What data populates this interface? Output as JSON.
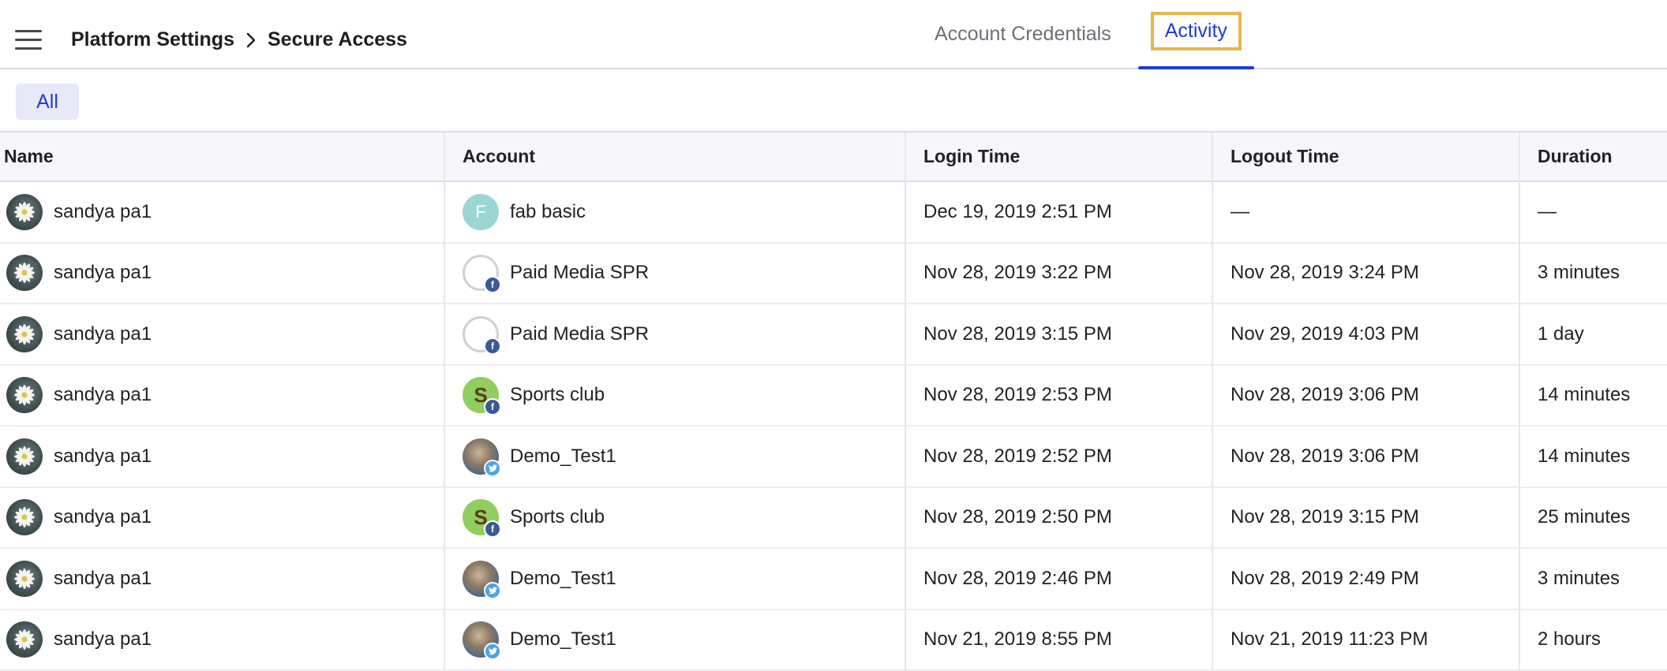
{
  "header": {
    "breadcrumb": [
      "Platform Settings",
      "Secure Access"
    ],
    "tabs": [
      {
        "label": "Account Credentials",
        "active": false
      },
      {
        "label": "Activity",
        "active": true
      }
    ],
    "accent_color": "#1c3ccf",
    "highlight_color": "#e8b64c"
  },
  "filters": {
    "chip": "All"
  },
  "table": {
    "columns": [
      "Name",
      "Account",
      "Login Time",
      "Logout Time",
      "Duration"
    ],
    "rows": [
      {
        "name": "sandya pa1",
        "account": "fab basic",
        "account_avatar": "letter-F",
        "network": "",
        "login": "Dec 19, 2019 2:51 PM",
        "logout": "—",
        "duration": "—"
      },
      {
        "name": "sandya pa1",
        "account": "Paid Media SPR",
        "account_avatar": "placeholder",
        "network": "facebook",
        "login": "Nov 28, 2019 3:22 PM",
        "logout": "Nov 28, 2019 3:24 PM",
        "duration": "3 minutes"
      },
      {
        "name": "sandya pa1",
        "account": "Paid Media SPR",
        "account_avatar": "placeholder",
        "network": "facebook",
        "login": "Nov 28, 2019 3:15 PM",
        "logout": "Nov 29, 2019 4:03 PM",
        "duration": "1 day"
      },
      {
        "name": "sandya pa1",
        "account": "Sports club",
        "account_avatar": "letter-S",
        "network": "facebook",
        "login": "Nov 28, 2019 2:53 PM",
        "logout": "Nov 28, 2019 3:06 PM",
        "duration": "14 minutes"
      },
      {
        "name": "sandya pa1",
        "account": "Demo_Test1",
        "account_avatar": "photo",
        "network": "twitter",
        "login": "Nov 28, 2019 2:52 PM",
        "logout": "Nov 28, 2019 3:06 PM",
        "duration": "14 minutes"
      },
      {
        "name": "sandya pa1",
        "account": "Sports club",
        "account_avatar": "letter-S",
        "network": "facebook",
        "login": "Nov 28, 2019 2:50 PM",
        "logout": "Nov 28, 2019 3:15 PM",
        "duration": "25 minutes"
      },
      {
        "name": "sandya pa1",
        "account": "Demo_Test1",
        "account_avatar": "photo",
        "network": "twitter",
        "login": "Nov 28, 2019 2:46 PM",
        "logout": "Nov 28, 2019 2:49 PM",
        "duration": "3 minutes"
      },
      {
        "name": "sandya pa1",
        "account": "Demo_Test1",
        "account_avatar": "photo",
        "network": "twitter",
        "login": "Nov 21, 2019 8:55 PM",
        "logout": "Nov 21, 2019 11:23 PM",
        "duration": "2 hours"
      }
    ]
  }
}
